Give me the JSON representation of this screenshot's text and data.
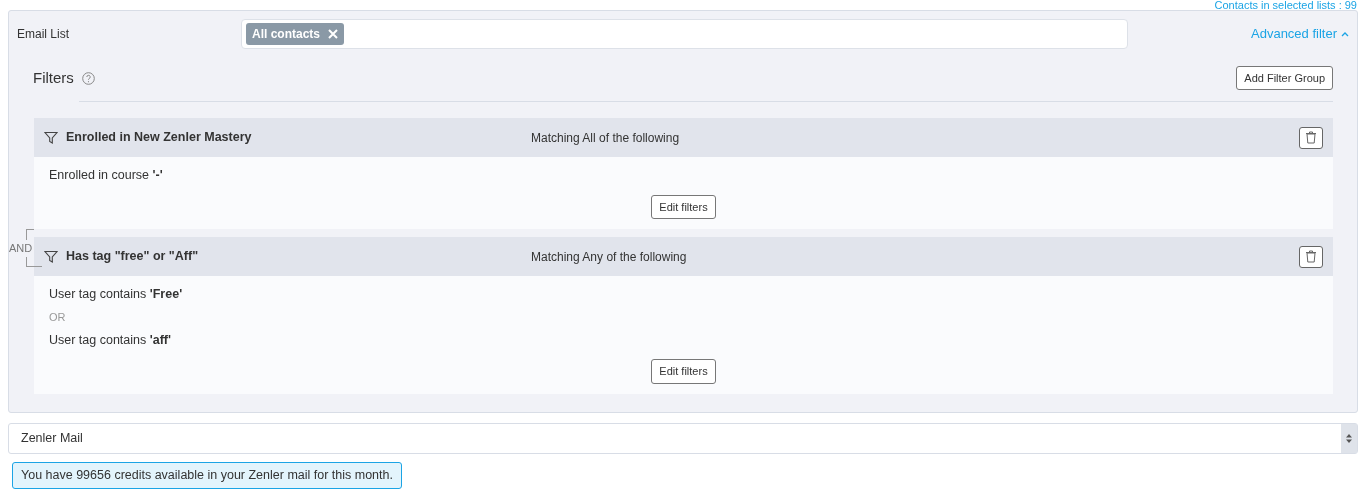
{
  "contacts_count": "Contacts in selected lists : 99",
  "email_list": {
    "label": "Email List",
    "tags": [
      "All contacts"
    ]
  },
  "advanced_filter": {
    "label": "Advanced filter",
    "expanded": true
  },
  "filters": {
    "title": "Filters",
    "add_button": "Add Filter Group",
    "joiner": "AND",
    "groups": [
      {
        "title": "Enrolled in New Zenler Mastery",
        "matching": "Matching All of the following",
        "conditions": [
          "Enrolled in course **'-'**"
        ],
        "edit_button": "Edit filters"
      },
      {
        "title": "Has tag \"free\" or \"Aff\"",
        "matching": "Matching Any of the following",
        "separator": "OR",
        "conditions": [
          "User tag contains **'Free'**",
          "User tag contains **'aff'**"
        ],
        "edit_button": "Edit filters"
      }
    ]
  },
  "mail_select": {
    "value": "Zenler Mail"
  },
  "credits_alert": "You have 99656 credits available in your Zenler mail for this month."
}
